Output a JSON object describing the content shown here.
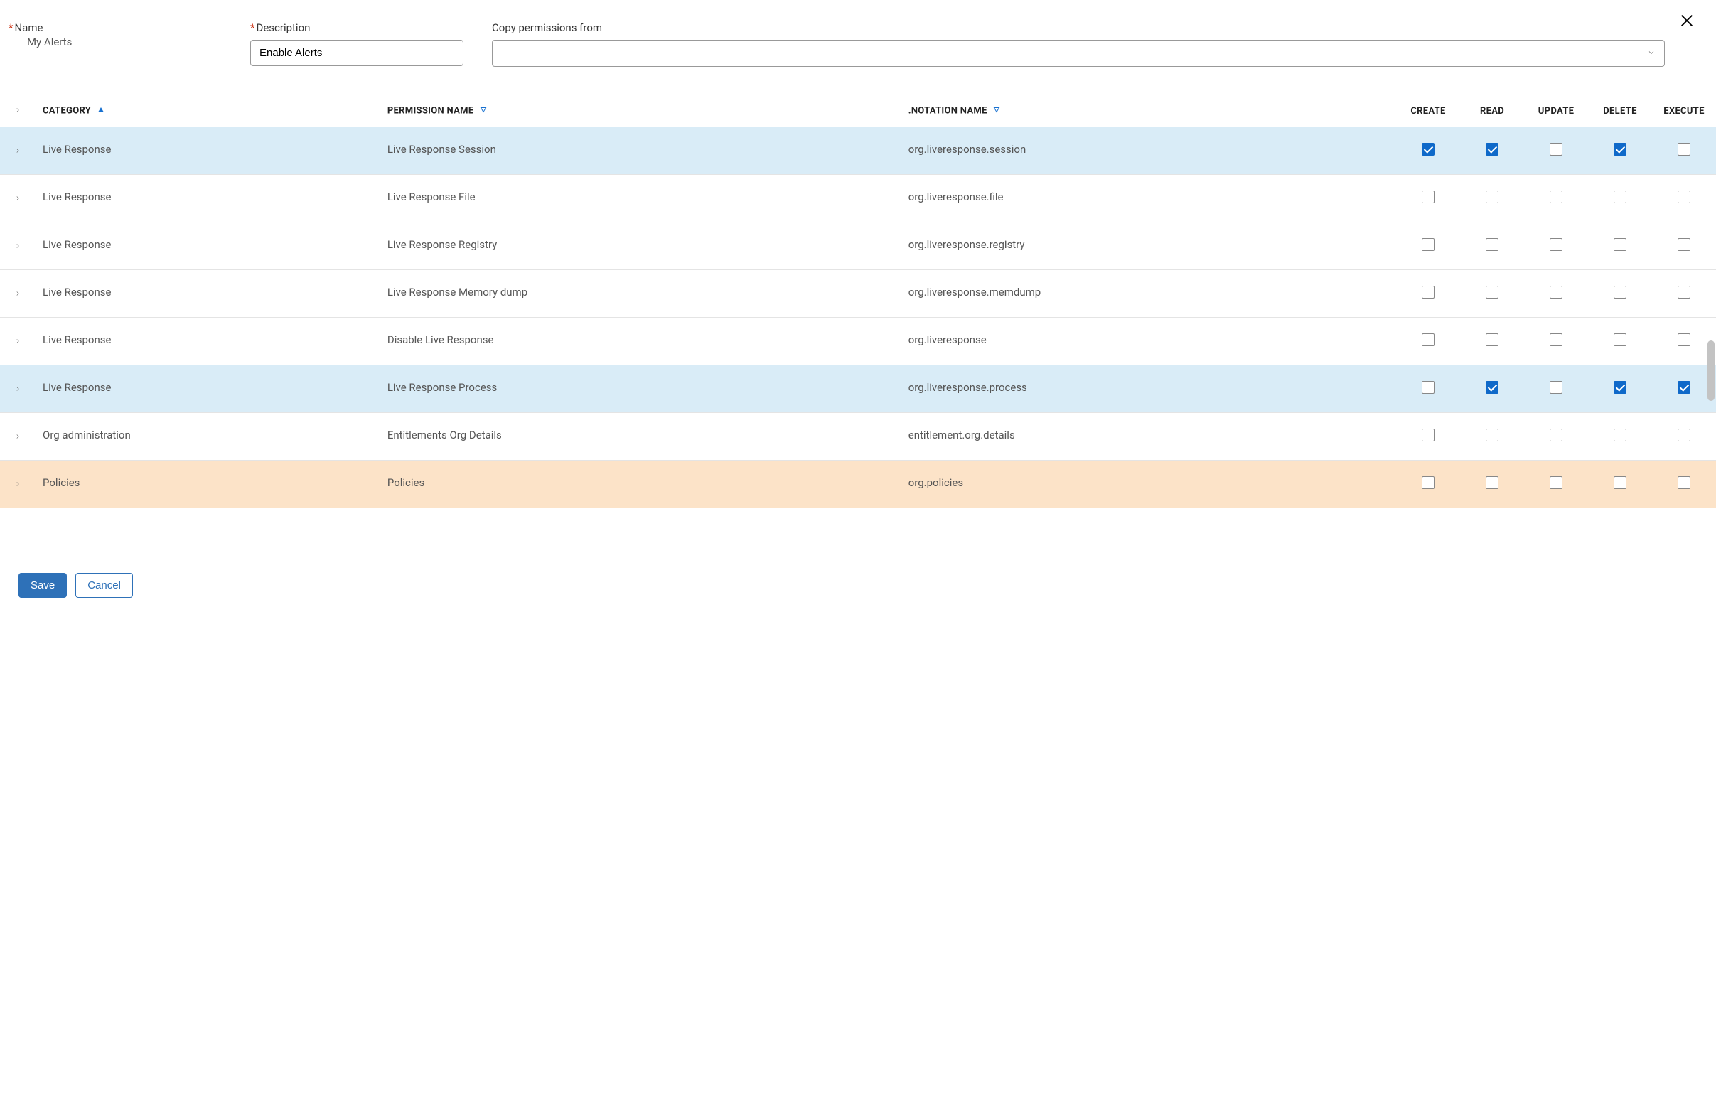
{
  "labels": {
    "name": "Name",
    "description": "Description",
    "copy_from": "Copy permissions from"
  },
  "form": {
    "name_value": "My Alerts",
    "description_value": "Enable Alerts",
    "copy_from_value": ""
  },
  "table": {
    "headers": {
      "category": "CATEGORY",
      "permission_name": "PERMISSION NAME",
      "notation_name": ".NOTATION NAME",
      "create": "CREATE",
      "read": "READ",
      "update": "UPDATE",
      "delete": "DELETE",
      "execute": "EXECUTE"
    },
    "rows": [
      {
        "category": "Live Response",
        "permission_name": "Live Response Session",
        "notation_name": "org.liveresponse.session",
        "create": true,
        "read": true,
        "update": false,
        "delete": true,
        "execute": false,
        "state": "selected"
      },
      {
        "category": "Live Response",
        "permission_name": "Live Response File",
        "notation_name": "org.liveresponse.file",
        "create": false,
        "read": false,
        "update": false,
        "delete": false,
        "execute": false,
        "state": "normal"
      },
      {
        "category": "Live Response",
        "permission_name": "Live Response Registry",
        "notation_name": "org.liveresponse.registry",
        "create": false,
        "read": false,
        "update": false,
        "delete": false,
        "execute": false,
        "state": "normal"
      },
      {
        "category": "Live Response",
        "permission_name": "Live Response Memory dump",
        "notation_name": "org.liveresponse.memdump",
        "create": false,
        "read": false,
        "update": false,
        "delete": false,
        "execute": false,
        "state": "normal"
      },
      {
        "category": "Live Response",
        "permission_name": "Disable Live Response",
        "notation_name": "org.liveresponse",
        "create": false,
        "read": false,
        "update": false,
        "delete": false,
        "execute": false,
        "state": "normal"
      },
      {
        "category": "Live Response",
        "permission_name": "Live Response Process",
        "notation_name": "org.liveresponse.process",
        "create": false,
        "read": true,
        "update": false,
        "delete": true,
        "execute": true,
        "state": "selected"
      },
      {
        "category": "Org administration",
        "permission_name": "Entitlements Org Details",
        "notation_name": "entitlement.org.details",
        "create": false,
        "read": false,
        "update": false,
        "delete": false,
        "execute": false,
        "state": "normal"
      },
      {
        "category": "Policies",
        "permission_name": "Policies",
        "notation_name": "org.policies",
        "create": false,
        "read": false,
        "update": false,
        "delete": false,
        "execute": false,
        "state": "hover"
      }
    ]
  },
  "buttons": {
    "save": "Save",
    "cancel": "Cancel"
  }
}
